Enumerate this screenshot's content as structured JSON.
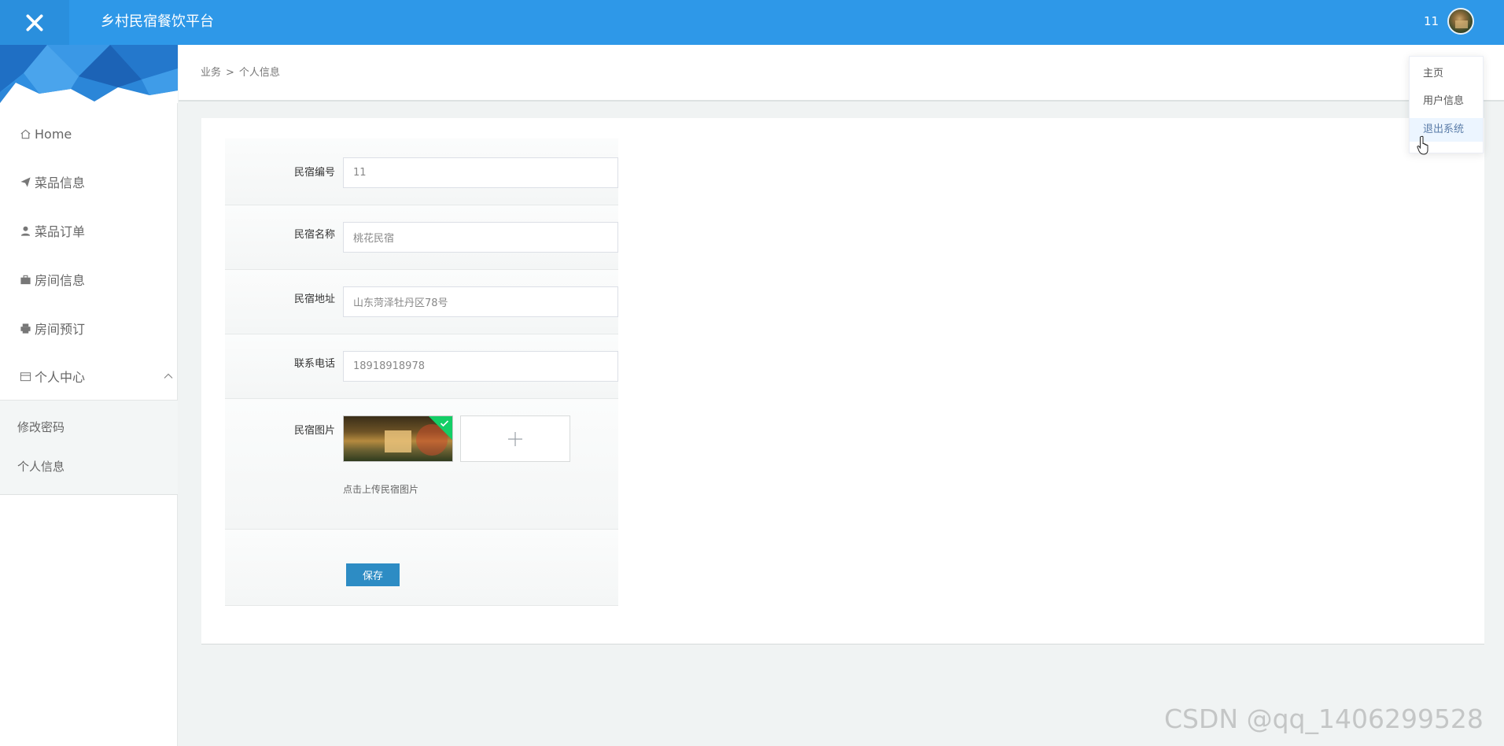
{
  "header": {
    "title": "乡村民宿餐饮平台",
    "user_id": "11",
    "accent_color": "#2e98e8"
  },
  "sidebar": {
    "items": [
      {
        "label": "Home",
        "icon": "home-icon"
      },
      {
        "label": "菜品信息",
        "icon": "send-icon"
      },
      {
        "label": "菜品订单",
        "icon": "user-icon"
      },
      {
        "label": "房间信息",
        "icon": "briefcase-icon"
      },
      {
        "label": "房间预订",
        "icon": "printer-icon"
      },
      {
        "label": "个人中心",
        "icon": "wallet-icon",
        "expanded": true
      }
    ],
    "submenu": [
      {
        "label": "修改密码"
      },
      {
        "label": "个人信息"
      }
    ]
  },
  "breadcrumb": {
    "parent": "业务",
    "separator": ">",
    "current": "个人信息"
  },
  "form": {
    "fields": [
      {
        "label": "民宿编号",
        "value": "11"
      },
      {
        "label": "民宿名称",
        "value": "桃花民宿"
      },
      {
        "label": "民宿地址",
        "value": "山东菏泽牡丹区78号"
      },
      {
        "label": "联系电话",
        "value": "18918918978"
      }
    ],
    "image": {
      "label": "民宿图片",
      "hint": "点击上传民宿图片"
    },
    "save_label": "保存"
  },
  "dropdown": {
    "items": [
      {
        "label": "主页"
      },
      {
        "label": "用户信息"
      },
      {
        "label": "退出系统",
        "hovered": true
      }
    ]
  },
  "watermark": "CSDN @qq_1406299528"
}
